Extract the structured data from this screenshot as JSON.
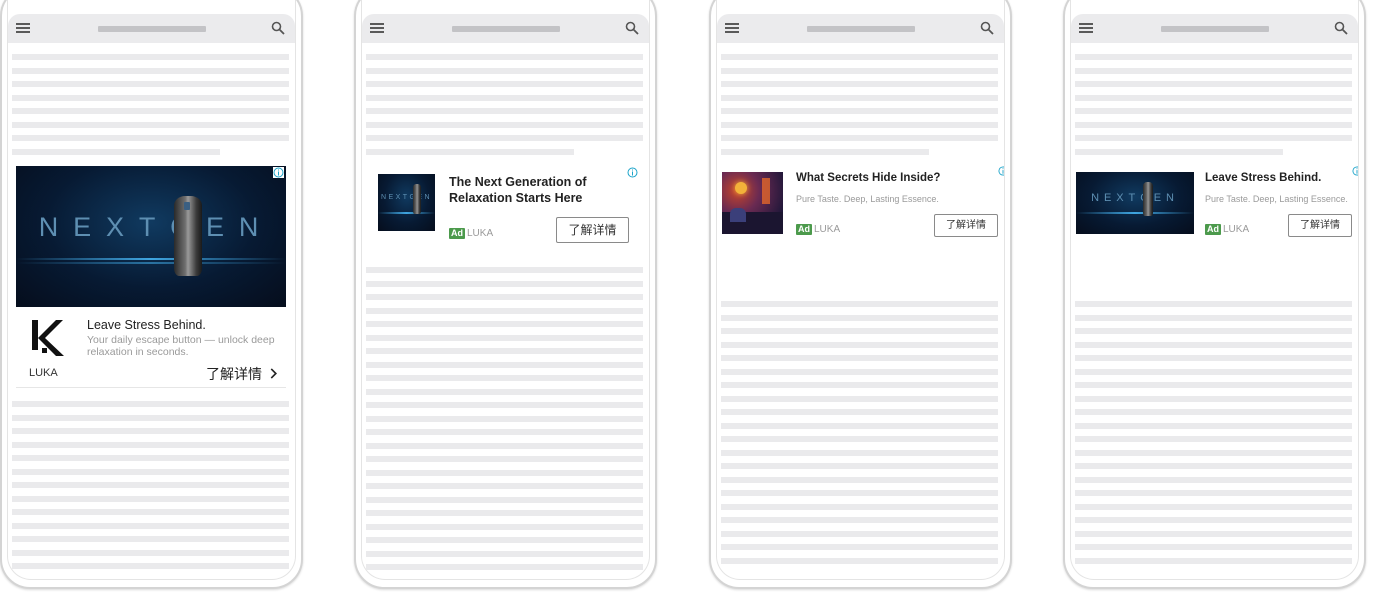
{
  "colors": {
    "ad_badge": "#4c9a4c",
    "info_icon": "#1aa3c9",
    "placeholder_line": "#eaeaec",
    "browser_bar": "#ebebed"
  },
  "icons": {
    "menu": "hamburger-icon",
    "search": "search-icon",
    "info": "info-icon",
    "arrow": "chevron-right-icon"
  },
  "phones": [
    {
      "banner_text": "NEXTGEN",
      "headline": "Leave Stress Behind.",
      "body": "Your daily escape button — unlock deep relaxation in seconds.",
      "advertiser": "LUKA",
      "cta": "了解详情"
    },
    {
      "thumb_text": "NEXTGEN",
      "headline": "The Next Generation of Relaxation Starts Here",
      "ad_badge": "Ad",
      "advertiser": "LUKA",
      "cta": "了解详情"
    },
    {
      "headline": "What Secrets Hide Inside?",
      "body": "Pure Taste. Deep, Lasting Essence.",
      "ad_badge": "Ad",
      "advertiser": "LUKA",
      "cta": "了解详情"
    },
    {
      "thumb_text": "NEXTGEN",
      "headline": "Leave Stress Behind.",
      "body": "Pure Taste. Deep, Lasting Essence.",
      "ad_badge": "Ad",
      "advertiser": "LUKA",
      "cta": "了解详情"
    }
  ]
}
